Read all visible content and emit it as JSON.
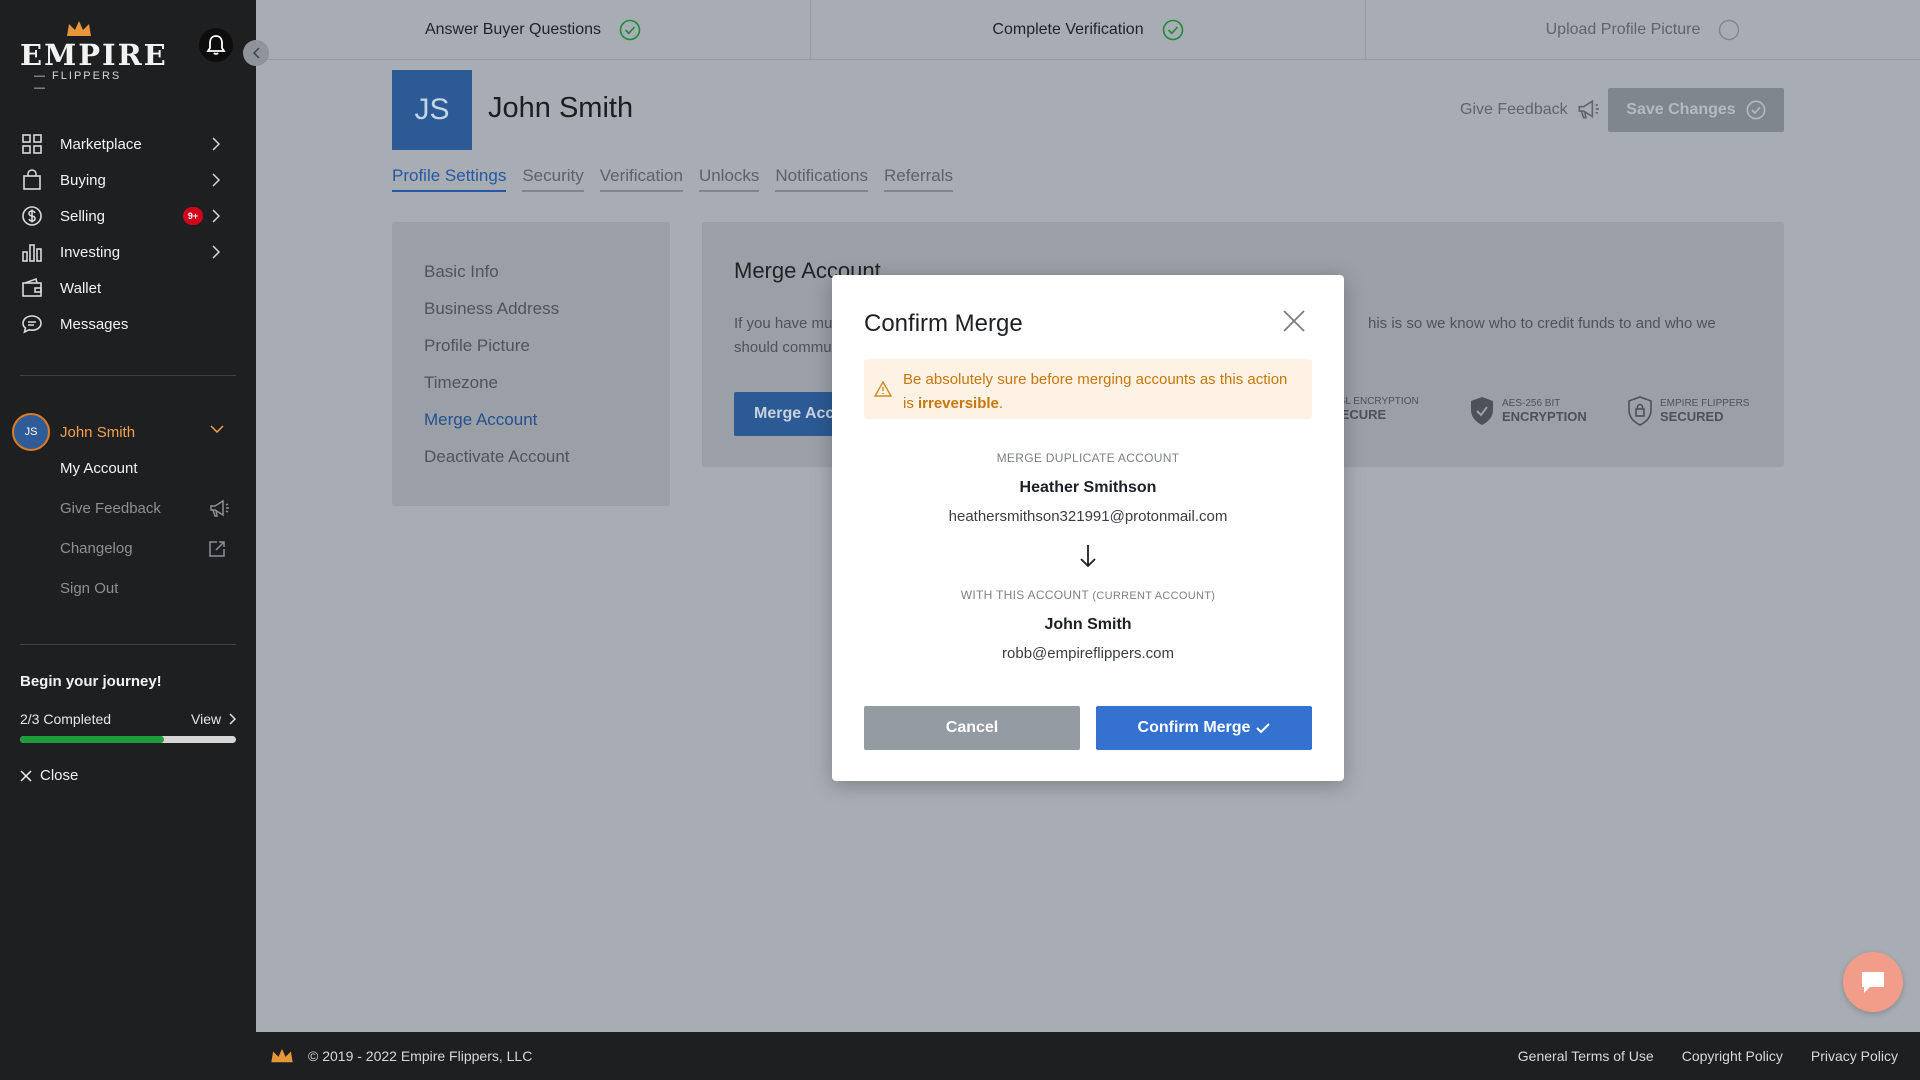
{
  "brand": {
    "logo_word": "EMPIRE",
    "logo_sub": "— FLIPPERS —",
    "accent": "#e07b22",
    "primary": "#3572d0"
  },
  "sidebar": {
    "items": [
      {
        "label": "Marketplace",
        "icon": "grid-icon",
        "chevron": true
      },
      {
        "label": "Buying",
        "icon": "bag-icon",
        "chevron": true
      },
      {
        "label": "Selling",
        "icon": "dollar-icon",
        "chevron": true,
        "badge": "9+"
      },
      {
        "label": "Investing",
        "icon": "bar-chart-icon",
        "chevron": true
      },
      {
        "label": "Wallet",
        "icon": "wallet-icon",
        "chevron": false
      },
      {
        "label": "Messages",
        "icon": "chat-icon",
        "chevron": false
      }
    ],
    "user": {
      "initials": "JS",
      "name": "John Smith",
      "menu": [
        {
          "label": "My Account"
        },
        {
          "label": "Give Feedback",
          "icon": "megaphone-icon"
        },
        {
          "label": "Changelog",
          "icon": "external-link-icon"
        },
        {
          "label": "Sign Out"
        }
      ]
    },
    "journey": {
      "title": "Begin your journey!",
      "count": "2/3 Completed",
      "view_label": "View",
      "progress": 0.667,
      "close_label": "Close"
    }
  },
  "steps": [
    {
      "label": "Answer Buyer Questions",
      "done": true
    },
    {
      "label": "Complete Verification",
      "done": true
    },
    {
      "label": "Upload Profile Picture",
      "done": false
    }
  ],
  "header": {
    "initials": "JS",
    "name": "John Smith",
    "feedback_label": "Give Feedback",
    "save_label": "Save Changes"
  },
  "tabs": [
    {
      "label": "Profile Settings",
      "active": true
    },
    {
      "label": "Security",
      "active": false
    },
    {
      "label": "Verification",
      "active": false
    },
    {
      "label": "Unlocks",
      "active": false
    },
    {
      "label": "Notifications",
      "active": false
    },
    {
      "label": "Referrals",
      "active": false
    }
  ],
  "settings_menu": [
    {
      "label": "Basic Info",
      "active": false
    },
    {
      "label": "Business Address",
      "active": false
    },
    {
      "label": "Profile Picture",
      "active": false
    },
    {
      "label": "Timezone",
      "active": false
    },
    {
      "label": "Merge Account",
      "active": true
    },
    {
      "label": "Deactivate Account",
      "active": false
    }
  ],
  "main": {
    "title": "Merge Account",
    "desc_left": "If you have mu",
    "desc_left2": "should commu",
    "desc_right": "his is so we know who to credit funds to and who we",
    "button_label": "Merge Acc",
    "badges": [
      {
        "line1": "SSL ENCRYPTION",
        "line2": "SECURE",
        "icon": "lock-icon"
      },
      {
        "line1": "AES-256 BIT",
        "line2": "ENCRYPTION",
        "icon": "shield-check-icon"
      },
      {
        "line1": "EMPIRE FLIPPERS",
        "line2": "SECURED",
        "icon": "shield-lock-icon"
      }
    ]
  },
  "modal": {
    "title": "Confirm Merge",
    "warning_prefix": "Be absolutely sure before merging accounts as this action is ",
    "warning_bold": "irreversible",
    "warning_suffix": ".",
    "duplicate_label": "MERGE DUPLICATE ACCOUNT",
    "duplicate_name": "Heather Smithson",
    "duplicate_email": "heathersmithson321991@protonmail.com",
    "current_label": "WITH THIS ACCOUNT",
    "current_label_small": "(CURRENT ACCOUNT)",
    "current_name": "John Smith",
    "current_email": "robb@empireflippers.com",
    "cancel_label": "Cancel",
    "confirm_label": "Confirm Merge"
  },
  "footer": {
    "copyright": "© 2019 - 2022 Empire Flippers, LLC",
    "links": [
      "General Terms of Use",
      "Copyright Policy",
      "Privacy Policy"
    ]
  }
}
